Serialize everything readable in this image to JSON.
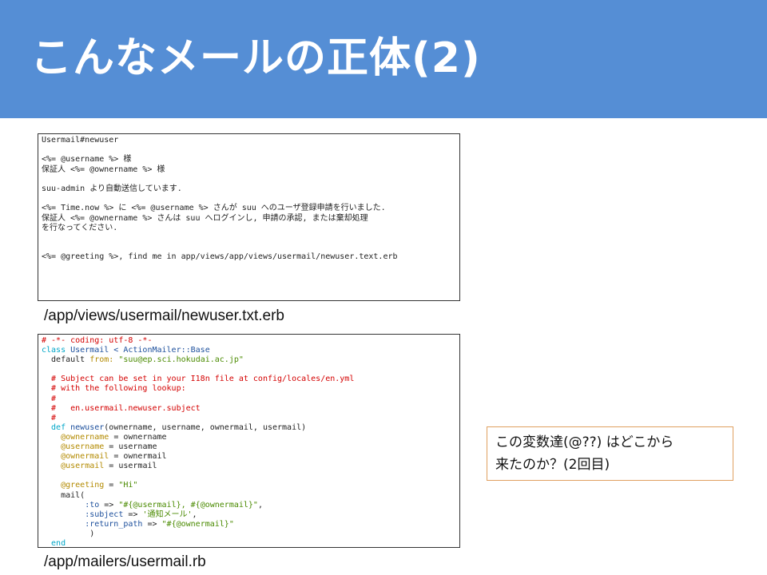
{
  "slide": {
    "title": "こんなメールの正体(2)"
  },
  "template_box": {
    "lines": [
      "Usermail#newuser",
      "",
      "<%= @username %> 様",
      "保証人 <%= @ownername %> 様",
      "",
      "suu-admin より自動送信しています.",
      "",
      "<%= Time.now %> に <%= @username %> さんが suu へのユーザ登録申請を行いました.",
      "保証人 <%= @ownername %> さんは suu へログインし, 申請の承認, または棄却処理",
      "を行なってください.",
      "",
      "",
      "<%= @greeting %>, find me in app/views/app/views/usermail/newuser.text.erb"
    ],
    "path": "/app/views/usermail/newuser.txt.erb"
  },
  "mailer_box": {
    "lines": [
      {
        "segments": [
          {
            "t": "# -*- coding: utf-8 -*-",
            "c": "c-red"
          }
        ]
      },
      {
        "segments": [
          {
            "t": "class ",
            "c": "c-cyan"
          },
          {
            "t": "Usermail < ActionMailer::Base",
            "c": "c-blue"
          }
        ]
      },
      {
        "segments": [
          {
            "t": "  default ",
            "c": ""
          },
          {
            "t": "from:",
            "c": "c-olive"
          },
          {
            "t": " ",
            "c": ""
          },
          {
            "t": "\"suu@ep.sci.hokudai.ac.jp\"",
            "c": "c-green"
          }
        ]
      },
      {
        "segments": [
          {
            "t": "",
            "c": ""
          }
        ]
      },
      {
        "segments": [
          {
            "t": "  # Subject can be set in your I18n file at config/locales/en.yml",
            "c": "c-red"
          }
        ]
      },
      {
        "segments": [
          {
            "t": "  # with the following lookup:",
            "c": "c-red"
          }
        ]
      },
      {
        "segments": [
          {
            "t": "  #",
            "c": "c-red"
          }
        ]
      },
      {
        "segments": [
          {
            "t": "  #   en.usermail.newuser.subject",
            "c": "c-red"
          }
        ]
      },
      {
        "segments": [
          {
            "t": "  #",
            "c": "c-red"
          }
        ]
      },
      {
        "segments": [
          {
            "t": "  def ",
            "c": "c-cyan"
          },
          {
            "t": "newuser",
            "c": "c-blue"
          },
          {
            "t": "(ownername, username, ownermail, usermail)",
            "c": ""
          }
        ]
      },
      {
        "segments": [
          {
            "t": "    ",
            "c": ""
          },
          {
            "t": "@ownername",
            "c": "c-olive"
          },
          {
            "t": " = ownername",
            "c": ""
          }
        ]
      },
      {
        "segments": [
          {
            "t": "    ",
            "c": ""
          },
          {
            "t": "@username",
            "c": "c-olive"
          },
          {
            "t": " = username",
            "c": ""
          }
        ]
      },
      {
        "segments": [
          {
            "t": "    ",
            "c": ""
          },
          {
            "t": "@ownermail",
            "c": "c-olive"
          },
          {
            "t": " = ownermail",
            "c": ""
          }
        ]
      },
      {
        "segments": [
          {
            "t": "    ",
            "c": ""
          },
          {
            "t": "@usermail",
            "c": "c-olive"
          },
          {
            "t": " = usermail",
            "c": ""
          }
        ]
      },
      {
        "segments": [
          {
            "t": "",
            "c": ""
          }
        ]
      },
      {
        "segments": [
          {
            "t": "    ",
            "c": ""
          },
          {
            "t": "@greeting",
            "c": "c-olive"
          },
          {
            "t": " = ",
            "c": ""
          },
          {
            "t": "\"Hi\"",
            "c": "c-green"
          }
        ]
      },
      {
        "segments": [
          {
            "t": "    mail(",
            "c": ""
          }
        ]
      },
      {
        "segments": [
          {
            "t": "         ",
            "c": ""
          },
          {
            "t": ":to",
            "c": "c-blue"
          },
          {
            "t": " => ",
            "c": ""
          },
          {
            "t": "\"#{@usermail}, #{@ownermail}\"",
            "c": "c-green"
          },
          {
            "t": ",",
            "c": ""
          }
        ]
      },
      {
        "segments": [
          {
            "t": "         ",
            "c": ""
          },
          {
            "t": ":subject",
            "c": "c-blue"
          },
          {
            "t": " => ",
            "c": ""
          },
          {
            "t": "'通知メール'",
            "c": "c-green"
          },
          {
            "t": ",",
            "c": ""
          }
        ]
      },
      {
        "segments": [
          {
            "t": "         ",
            "c": ""
          },
          {
            "t": ":return_path",
            "c": "c-blue"
          },
          {
            "t": " => ",
            "c": ""
          },
          {
            "t": "\"#{@ownermail}\"",
            "c": "c-green"
          }
        ]
      },
      {
        "segments": [
          {
            "t": "          )",
            "c": ""
          }
        ]
      },
      {
        "segments": [
          {
            "t": "  end",
            "c": "c-cyan"
          }
        ]
      }
    ],
    "path": "/app/mailers/usermail.rb"
  },
  "note": {
    "line1": "この変数達(@??) はどこから",
    "line2": "来たのか？(2回目)"
  },
  "colors": {
    "title_bar": "#558ed5",
    "note_border": "#e0a060"
  }
}
